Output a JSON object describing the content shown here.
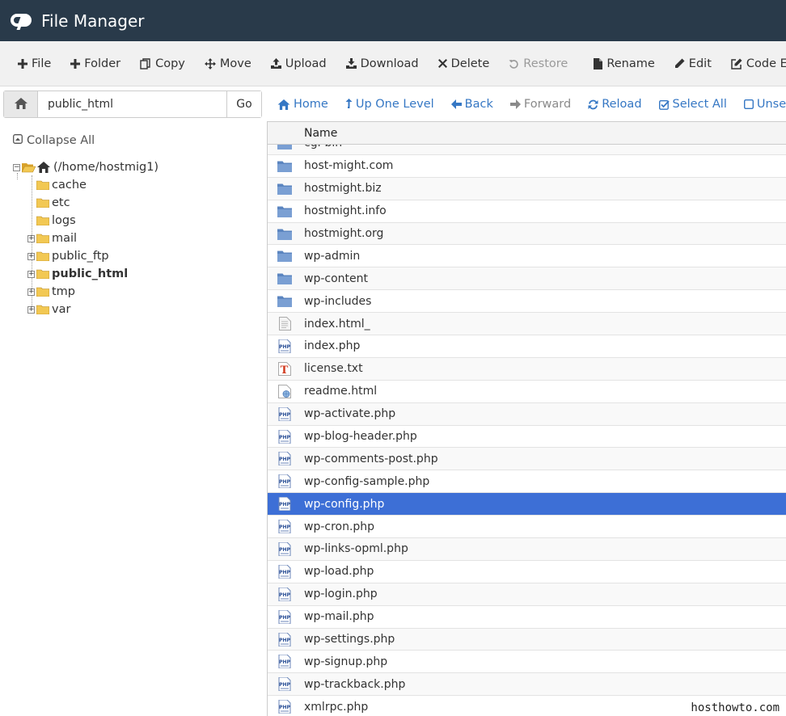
{
  "app": {
    "title": "File Manager"
  },
  "toolbar": {
    "file": "File",
    "folder": "Folder",
    "copy": "Copy",
    "move": "Move",
    "upload": "Upload",
    "download": "Download",
    "delete": "Delete",
    "restore": "Restore",
    "rename": "Rename",
    "edit": "Edit",
    "code_editor": "Code Editor"
  },
  "pathbar": {
    "value": "public_html",
    "go": "Go"
  },
  "nav": {
    "home": "Home",
    "up_one_level": "Up One Level",
    "back": "Back",
    "forward": "Forward",
    "reload": "Reload",
    "select_all": "Select All",
    "unselect": "Unselect"
  },
  "tree": {
    "collapse_all": "Collapse All",
    "root": "(/home/hostmig1)",
    "children": [
      {
        "label": "cache",
        "expandable": false
      },
      {
        "label": "etc",
        "expandable": false
      },
      {
        "label": "logs",
        "expandable": false
      },
      {
        "label": "mail",
        "expandable": true
      },
      {
        "label": "public_ftp",
        "expandable": true
      },
      {
        "label": "public_html",
        "expandable": true,
        "bold": true
      },
      {
        "label": "tmp",
        "expandable": true
      },
      {
        "label": "var",
        "expandable": true
      }
    ]
  },
  "filelist": {
    "column_name": "Name",
    "files": [
      {
        "name": "cgi-bin",
        "type": "folder"
      },
      {
        "name": "host-might.com",
        "type": "folder"
      },
      {
        "name": "hostmight.biz",
        "type": "folder"
      },
      {
        "name": "hostmight.info",
        "type": "folder"
      },
      {
        "name": "hostmight.org",
        "type": "folder"
      },
      {
        "name": "wp-admin",
        "type": "folder"
      },
      {
        "name": "wp-content",
        "type": "folder"
      },
      {
        "name": "wp-includes",
        "type": "folder"
      },
      {
        "name": "index.html_",
        "type": "generic"
      },
      {
        "name": "index.php",
        "type": "php"
      },
      {
        "name": "license.txt",
        "type": "text"
      },
      {
        "name": "readme.html",
        "type": "html"
      },
      {
        "name": "wp-activate.php",
        "type": "php"
      },
      {
        "name": "wp-blog-header.php",
        "type": "php"
      },
      {
        "name": "wp-comments-post.php",
        "type": "php"
      },
      {
        "name": "wp-config-sample.php",
        "type": "php"
      },
      {
        "name": "wp-config.php",
        "type": "php",
        "selected": true
      },
      {
        "name": "wp-cron.php",
        "type": "php"
      },
      {
        "name": "wp-links-opml.php",
        "type": "php"
      },
      {
        "name": "wp-load.php",
        "type": "php"
      },
      {
        "name": "wp-login.php",
        "type": "php"
      },
      {
        "name": "wp-mail.php",
        "type": "php"
      },
      {
        "name": "wp-settings.php",
        "type": "php"
      },
      {
        "name": "wp-signup.php",
        "type": "php"
      },
      {
        "name": "wp-trackback.php",
        "type": "php"
      },
      {
        "name": "xmlrpc.php",
        "type": "php"
      }
    ]
  },
  "watermark": "hosthowto.com",
  "colors": {
    "header_bg": "#293a4a",
    "link": "#3577c4",
    "selected_row": "#3d6fd6",
    "folder_icon": "#5b85c0",
    "tree_folder": "#e8b93a"
  }
}
